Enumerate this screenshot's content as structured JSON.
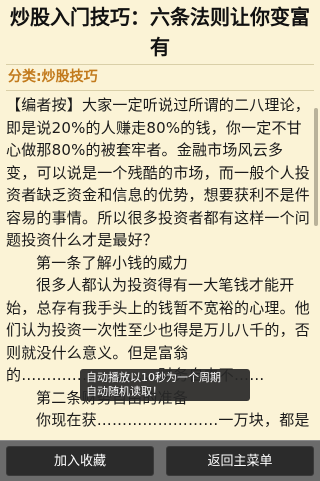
{
  "article": {
    "title": "炒股入门技巧：六条法则让你变富有",
    "category": "分类:炒股技巧",
    "paragraphs": [
      "【编者按】大家一定听说过所谓的二八理论，即是说20%的人赚走80%的钱，你一定不甘心做那80%的被套牢者。金融市场风云多变，可以说是一个残酷的市场，而一般个人投资者缺乏资金和信息的优势，想要获利不是件容易的事情。所以很多投资者都有这样一个问题投资什么才是最好？",
      "第一条了解小钱的威力",
      "很多人都认为投资得有一大笔钱才能开始，总存有我手头上的钱暂不宽裕的心理。他们认为投资一次性至少也得是万儿八千的，否则就没什么意义。但是富翁的……………………，财务自由不……",
      "第二条财务自由的准备",
      "你现在获……………………一万块，都是"
    ]
  },
  "toast": {
    "line1": "自动播放以10秒为一个周期",
    "line2": "自动随机读取！"
  },
  "bottom_bar": {
    "add_favorite": "加入收藏",
    "back_main_menu": "返回主菜单"
  }
}
